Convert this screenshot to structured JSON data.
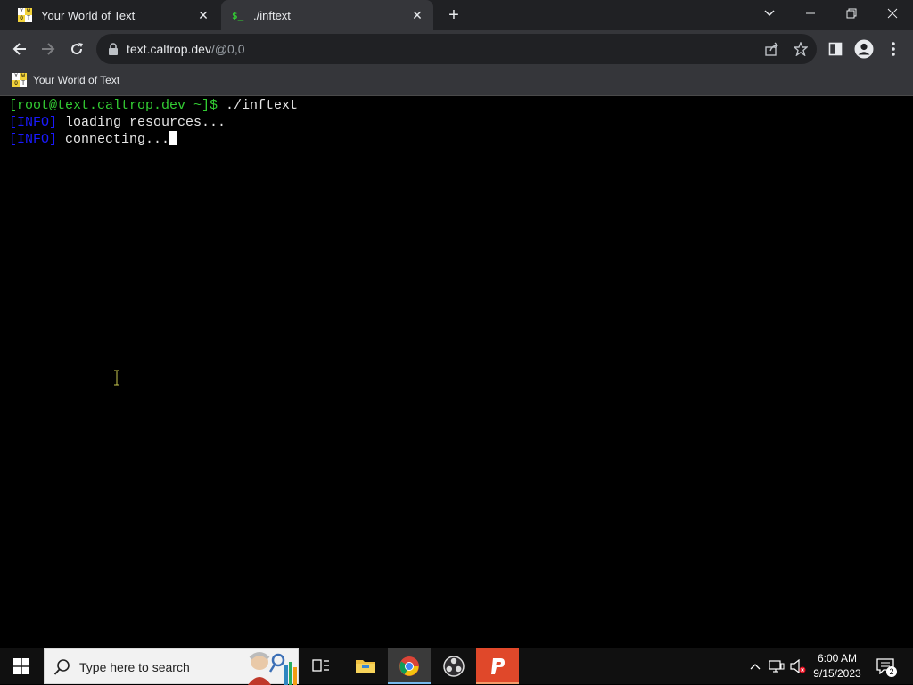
{
  "browser": {
    "tabs": [
      {
        "title": "Your World of Text",
        "favicon": "ywot-favicon",
        "active": false
      },
      {
        "title": "./inftext",
        "favicon": "terminal-favicon",
        "active": true
      }
    ],
    "tab_favicon_text": "$_",
    "ywot_favicon_letters": [
      "Y",
      "W",
      "O",
      "T"
    ],
    "address_bar": {
      "host": "text.caltrop.dev",
      "path": "/@0,0"
    },
    "bookmarks": [
      {
        "label": "Your World of Text",
        "favicon": "ywot-favicon"
      }
    ]
  },
  "terminal": {
    "prompt": "[root@text.caltrop.dev ~]$",
    "command": " ./inftext",
    "lines": [
      {
        "tag": "[INFO]",
        "text": " loading resources..."
      },
      {
        "tag": "[INFO]",
        "text": " connecting..."
      }
    ]
  },
  "taskbar": {
    "search_placeholder": "Type here to search",
    "apps": [
      "task-view",
      "file-explorer",
      "chrome",
      "obs",
      "pixelbook"
    ],
    "clock_time": "6:00 AM",
    "clock_date": "9/15/2023",
    "notification_count": "2"
  },
  "colors": {
    "tabstrip": "#202124",
    "toolbar": "#35363a",
    "prompt_green": "#33cc33",
    "info_blue": "#1a1aff",
    "terminal_bg": "#000000"
  }
}
